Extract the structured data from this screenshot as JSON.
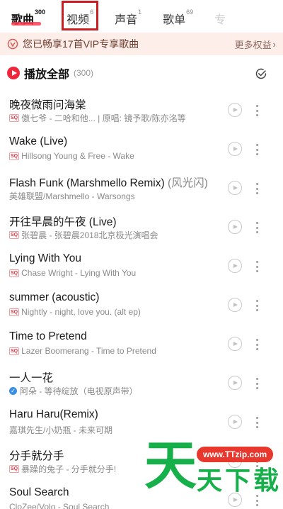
{
  "tabs": [
    {
      "label": "歌曲",
      "count": "300",
      "active": true
    },
    {
      "label": "视频",
      "count": "6",
      "active": false
    },
    {
      "label": "声音",
      "count": "1",
      "active": false
    },
    {
      "label": "歌单",
      "count": "69",
      "active": false
    },
    {
      "label": "专",
      "count": "",
      "active": false
    }
  ],
  "vip_banner": {
    "text": "您已畅享17首VIP专享歌曲",
    "more": "更多权益",
    "chevron": "›",
    "icon": "vip-badge-icon"
  },
  "play_all": {
    "label": "播放全部",
    "count": "(300)"
  },
  "songs": [
    {
      "title": "晚夜微雨问海棠",
      "suffix": "",
      "badge": "SQ",
      "meta": "傲七爷 - 二哈和他... | 原唱: 镜予歌/陈亦洺等"
    },
    {
      "title": "Wake (Live)",
      "suffix": "",
      "badge": "SQ",
      "meta": "Hillsong Young & Free - Wake"
    },
    {
      "title": "Flash Funk (Marshmello Remix) ",
      "suffix": "(风光闪)",
      "badge": "",
      "meta": "英雄联盟/Marshmello - Warsongs"
    },
    {
      "title": "开往早晨的午夜 (Live)",
      "suffix": "",
      "badge": "SQ",
      "meta": "张碧晨 - 张碧晨2018北京极光演唱会"
    },
    {
      "title": "Lying With You",
      "suffix": "",
      "badge": "SQ",
      "meta": "Chase Wright - Lying With You"
    },
    {
      "title": "summer (acoustic)",
      "suffix": "",
      "badge": "SQ",
      "meta": "Nightly - night, love you. (alt ep)"
    },
    {
      "title": "Time to Pretend",
      "suffix": "",
      "badge": "SQ",
      "meta": "Lazer Boomerang - Time to Pretend"
    },
    {
      "title": "一人一花",
      "suffix": "",
      "badge": "check",
      "meta": "阿朵 - 等待绽放（电视原声带）"
    },
    {
      "title": "Haru Haru(Remix)",
      "suffix": "",
      "badge": "",
      "meta": "嘉琪先生/小奶瓶 - 未来可期"
    },
    {
      "title": "分手就分手",
      "suffix": "",
      "badge": "SQ",
      "meta": "暴躁的兔子 - 分手就分手!"
    },
    {
      "title": "Soul Search",
      "suffix": "",
      "badge": "",
      "meta": "CloZee/Volo - Soul Search"
    }
  ],
  "watermark": {
    "big": "天",
    "url": "www.TTzip.com",
    "rest": "天下载"
  },
  "colors": {
    "accent": "#f0263a",
    "banner_bg": "#fdeeea",
    "highlight_box": "#c81e22",
    "watermark_green": "#15b04a"
  }
}
